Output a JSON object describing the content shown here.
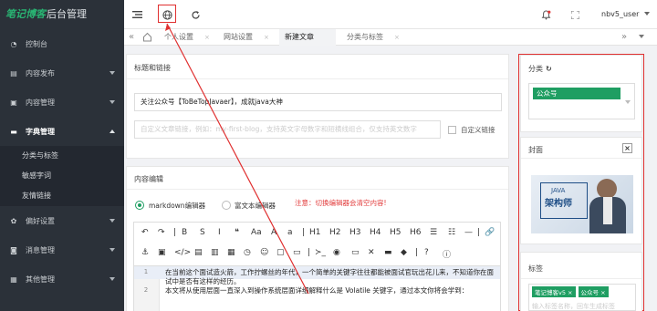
{
  "app": {
    "logo_main": "笔记博客",
    "logo_sub": "后台管理"
  },
  "sidebar": {
    "items": [
      {
        "label": "控制台",
        "icon": "dashboard-icon",
        "expandable": false
      },
      {
        "label": "内容发布",
        "icon": "edit-icon",
        "expandable": true
      },
      {
        "label": "内容管理",
        "icon": "content-icon",
        "expandable": true
      },
      {
        "label": "字典管理",
        "icon": "dictionary-icon",
        "expandable": true,
        "open": true
      },
      {
        "label": "偏好设置",
        "icon": "gear-icon",
        "expandable": true
      },
      {
        "label": "消息管理",
        "icon": "message-icon",
        "expandable": true
      },
      {
        "label": "其他管理",
        "icon": "other-icon",
        "expandable": true
      }
    ],
    "sub_items": [
      "分类与标签",
      "敏感字词",
      "友情链接"
    ]
  },
  "topbar": {
    "user": "nbv5_user"
  },
  "tabs": [
    {
      "label": "个人设置",
      "active": false
    },
    {
      "label": "网站设置",
      "active": false
    },
    {
      "label": "新建文章",
      "active": true
    },
    {
      "label": "分类与标签",
      "active": false
    }
  ],
  "title_section": {
    "header": "标题和链接",
    "title_value": "关注公众号【ToBeTopJavaer】，成就java大神",
    "link_placeholder": "自定义文章链接，例如：my-first-blog，支持英文字母数字和短横线组合，仅支持英文数字",
    "custom_link_label": "自定义链接"
  },
  "content_section": {
    "header": "内容编辑",
    "editor_md": "markdown编辑器",
    "editor_rich": "富文本编辑器",
    "warning": "注意：切换编辑器会清空内容!",
    "lines": [
      {
        "num": "1",
        "text": "在当前这个面试造火箭，工作拧螺丝的年代，一个简单的关键字往往都能被面试官玩出花儿来，不知道你在面试中是否有这样的经历。"
      },
      {
        "num": "2",
        "text": "本文将从使用层面一直深入到操作系统层面详细解释什么是 Volatile 关键字，通过本文你将会学到："
      }
    ]
  },
  "right": {
    "category_header": "分类",
    "category_selected": "公众号",
    "cover_header": "封面",
    "cover_text_top": "JAVA",
    "cover_text_main": "架构师",
    "tags_header": "标签",
    "tags": [
      "笔记博客v5",
      "公众号"
    ],
    "tags_placeholder": "输入标签名称，回车生成标签"
  }
}
